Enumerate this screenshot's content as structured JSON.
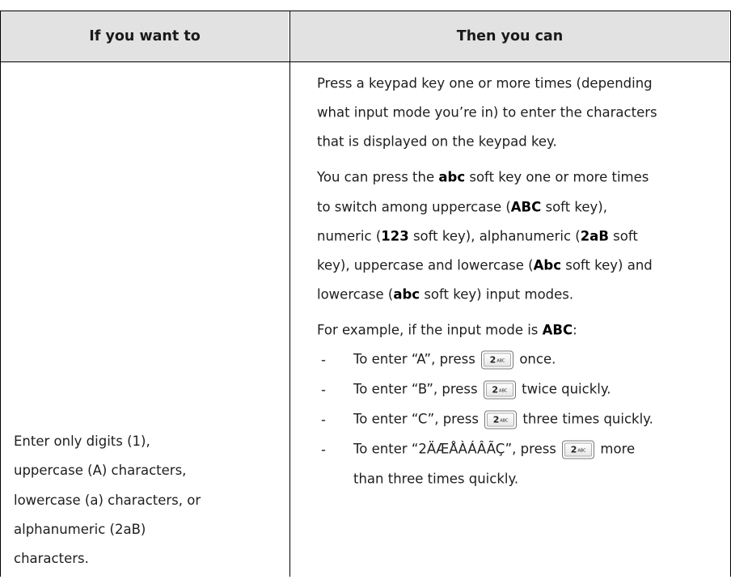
{
  "header": {
    "col1": "If you want to",
    "col2": "Then you can"
  },
  "left_cell": {
    "lines": [
      "Enter only digits (1),",
      "uppercase (A) characters,",
      "lowercase (a) characters, or",
      "alphanumeric (2aB)",
      "characters."
    ]
  },
  "right_cell": {
    "para1": [
      "Press a keypad key one or more times (depending",
      "what input mode you’re in) to enter the characters",
      "that is displayed on the keypad key."
    ],
    "para2": {
      "l1_pre": "You can press the ",
      "l1_bold": "abc",
      "l1_post": " soft key one or more times",
      "l2_pre": "to switch among uppercase (",
      "l2_bold": "ABC",
      "l2_post": " soft key),",
      "l3_pre": "numeric (",
      "l3_bold1": "123",
      "l3_mid": " soft key), alphanumeric (",
      "l3_bold2": "2aB",
      "l3_post": " soft",
      "l4_pre": "key), uppercase and lowercase (",
      "l4_bold": "Abc",
      "l4_post": " soft key) and",
      "l5_pre": "lowercase (",
      "l5_bold": "abc",
      "l5_post": " soft key) input modes."
    },
    "example": {
      "pre": "For example, if the input mode is ",
      "bold": "ABC",
      "post": ":"
    },
    "bullets": [
      {
        "dash": "-",
        "pre": "To enter “A”, press ",
        "post": " once."
      },
      {
        "dash": "-",
        "pre": "To enter “B”, press ",
        "post": " twice quickly."
      },
      {
        "dash": "-",
        "pre": "To enter “C”, press ",
        "post": " three times quickly."
      },
      {
        "dash": "-",
        "pre": "To enter “2ÄÆÅÀÁÂÃÇ”, press ",
        "post": " more",
        "cont": "than three times quickly."
      }
    ],
    "keypad_key": {
      "digit": "2",
      "letters": "ABC",
      "icon": "keypad-2-key-icon"
    }
  },
  "colors": {
    "header_bg": "#e2e2e2",
    "border": "#000000",
    "text": "#1e1e1e"
  }
}
